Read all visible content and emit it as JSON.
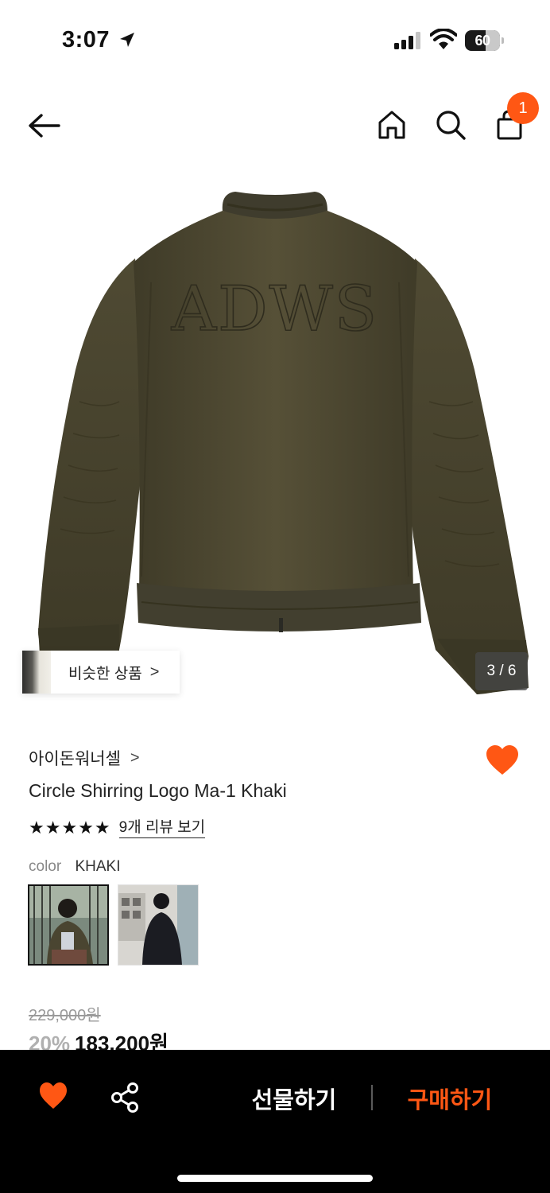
{
  "status_bar": {
    "time": "3:07",
    "battery": "60",
    "battery_level": 0.6
  },
  "nav": {
    "cart_badge": "1",
    "icons": [
      "back-arrow-icon",
      "home-icon",
      "search-icon",
      "cart-bag-icon"
    ]
  },
  "gallery": {
    "similar_label": "비슷한 상품",
    "similar_chevron": ">",
    "page_counter": "3 / 6",
    "jacket_logo_text": "ADWS"
  },
  "product": {
    "brand": "아이돈워너셀",
    "brand_chevron": ">",
    "name": "Circle Shirring Logo Ma-1 Khaki",
    "stars": "★★★★★",
    "rating": 5,
    "review_link": "9개 리뷰 보기",
    "color_label": "color",
    "color_value": "KHAKI",
    "original_price": "229,000원",
    "discount": "20%",
    "sale_price": "183,200원"
  },
  "bottom_bar": {
    "gift_label": "선물하기",
    "buy_label": "구매하기"
  },
  "colors": {
    "accent": "#ff5714",
    "jacket_khaki": "#4f4a34",
    "bottom_bar_bg": "#000000"
  }
}
